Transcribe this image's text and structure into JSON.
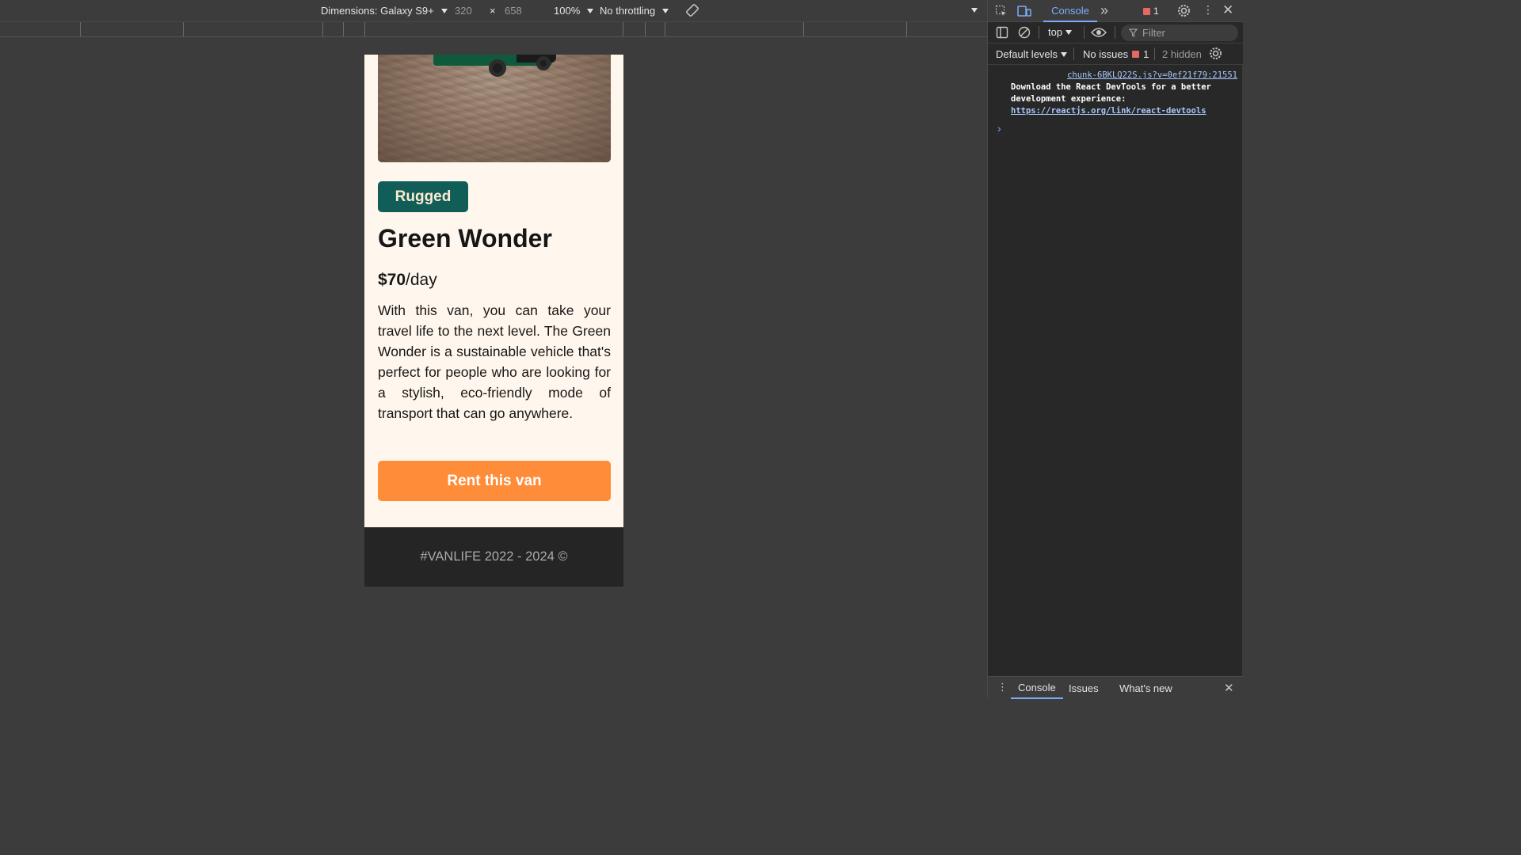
{
  "device_toolbar": {
    "dimensions_label": "Dimensions: Galaxy S9+",
    "width_value": "320",
    "times": "×",
    "height_value": "658",
    "zoom": "100%",
    "throttling": "No throttling"
  },
  "page": {
    "badge": "Rugged",
    "title": "Green Wonder",
    "price_amount": "$70",
    "price_unit": "/day",
    "description": "With this van, you can take your travel life to the next level. The Green Wonder is a sustainable vehicle that's perfect for people who are looking for a stylish, eco-friendly mode of transport that can go anywhere.",
    "rent_button": "Rent this van",
    "footer": "#VANLIFE 2022 - 2024 ©"
  },
  "devtools": {
    "active_tab": "Console",
    "more_tabs": "»",
    "error_count": "1",
    "context": "top",
    "filter_placeholder": "Filter",
    "levels": "Default levels",
    "issues_label": "No issues",
    "issues_count": "1",
    "hidden_label": "2 hidden",
    "message_source": "chunk-6BKLQ22S.js?v=0ef21f79:21551",
    "message_text": "Download the React DevTools for a better development experience: ",
    "message_link": "https://reactjs.org/link/react-devtools",
    "prompt": "›",
    "drawer_tabs": [
      "Console",
      "Issues",
      "What's new"
    ]
  },
  "colors": {
    "badge_bg": "#115e59",
    "rent_button_bg": "#ff8c38",
    "page_bg": "#fff7ed",
    "footer_bg": "#252525",
    "devtools_accent": "#7cacf8"
  }
}
